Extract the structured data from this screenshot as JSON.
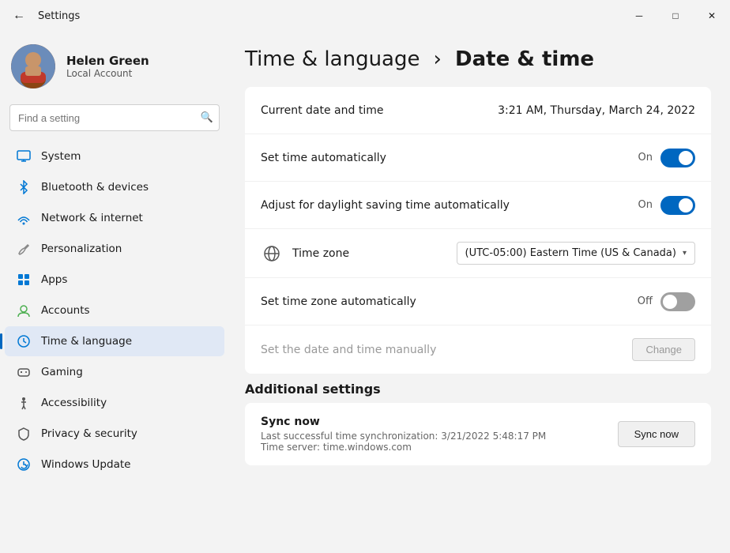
{
  "titlebar": {
    "title": "Settings",
    "minimize_label": "─",
    "maximize_label": "□",
    "close_label": "✕"
  },
  "sidebar": {
    "search_placeholder": "Find a setting",
    "user": {
      "name": "Helen Green",
      "account_type": "Local Account"
    },
    "nav_items": [
      {
        "id": "system",
        "label": "System",
        "icon": "monitor",
        "active": false
      },
      {
        "id": "bluetooth",
        "label": "Bluetooth & devices",
        "icon": "bluetooth",
        "active": false
      },
      {
        "id": "network",
        "label": "Network & internet",
        "icon": "network",
        "active": false
      },
      {
        "id": "personalization",
        "label": "Personalization",
        "icon": "brush",
        "active": false
      },
      {
        "id": "apps",
        "label": "Apps",
        "icon": "apps",
        "active": false
      },
      {
        "id": "accounts",
        "label": "Accounts",
        "icon": "accounts",
        "active": false
      },
      {
        "id": "time",
        "label": "Time & language",
        "icon": "time",
        "active": true
      },
      {
        "id": "gaming",
        "label": "Gaming",
        "icon": "gaming",
        "active": false
      },
      {
        "id": "accessibility",
        "label": "Accessibility",
        "icon": "accessibility",
        "active": false
      },
      {
        "id": "privacy",
        "label": "Privacy & security",
        "icon": "privacy",
        "active": false
      },
      {
        "id": "update",
        "label": "Windows Update",
        "icon": "update",
        "active": false
      }
    ]
  },
  "content": {
    "breadcrumb_parent": "Time & language",
    "breadcrumb_sep": "›",
    "breadcrumb_current": "Date & time",
    "settings": [
      {
        "id": "current-datetime",
        "label": "Current date and time",
        "value": "3:21 AM, Thursday, March 24, 2022",
        "type": "readonly"
      },
      {
        "id": "set-time-auto",
        "label": "Set time automatically",
        "toggle": "on",
        "toggle_label": "On",
        "type": "toggle"
      },
      {
        "id": "daylight-saving",
        "label": "Adjust for daylight saving time automatically",
        "toggle": "on",
        "toggle_label": "On",
        "type": "toggle"
      },
      {
        "id": "timezone",
        "label": "Time zone",
        "value": "(UTC-05:00) Eastern Time (US & Canada)",
        "type": "dropdown"
      },
      {
        "id": "set-timezone-auto",
        "label": "Set time zone automatically",
        "toggle": "off",
        "toggle_label": "Off",
        "type": "toggle"
      },
      {
        "id": "set-manually",
        "label": "Set the date and time manually",
        "button_label": "Change",
        "type": "button",
        "muted": true
      }
    ],
    "additional": {
      "label": "Additional settings",
      "sync": {
        "title": "Sync now",
        "detail_line1": "Last successful time synchronization: 3/21/2022 5:48:17 PM",
        "detail_line2": "Time server: time.windows.com",
        "button_label": "Sync now"
      }
    }
  }
}
